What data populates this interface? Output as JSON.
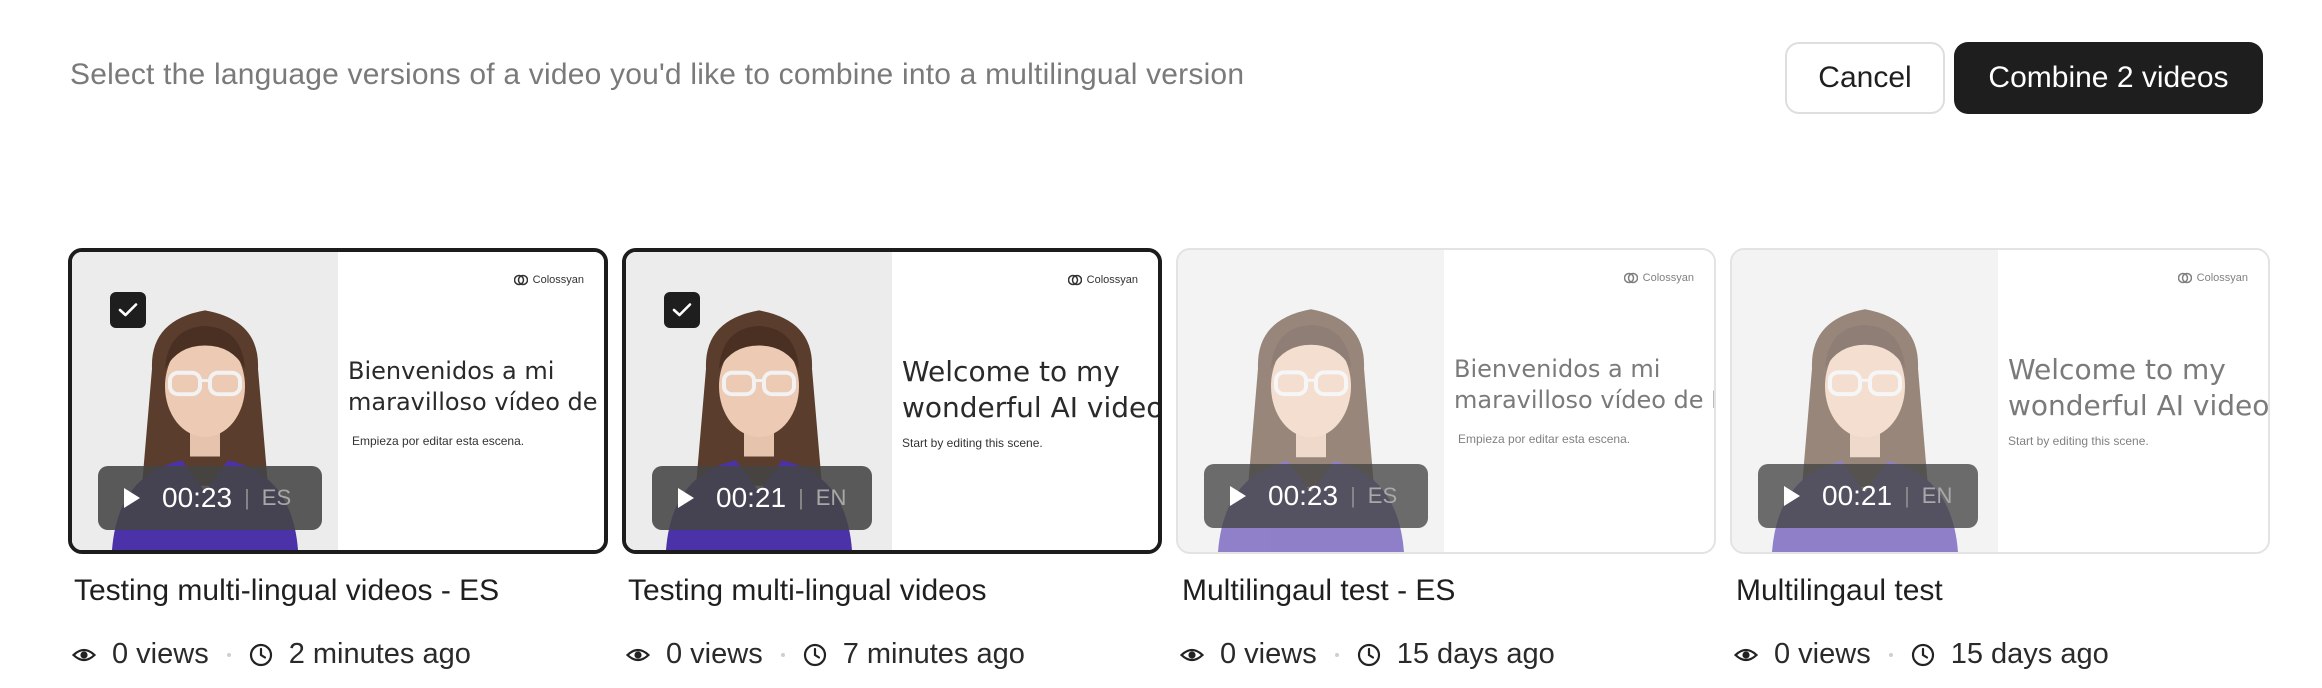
{
  "header": {
    "instruction": "Select the language versions of a video you'd like to combine into a multilingual version",
    "cancel_label": "Cancel",
    "combine_label": "Combine 2 videos"
  },
  "videos": [
    {
      "title": "Testing multi-lingual videos - ES",
      "duration": "00:23",
      "language": "ES",
      "views": "0 views",
      "age": "2 minutes ago",
      "selected": true,
      "brand": "Colossyan",
      "slide_heading_1": "Bienvenidos a mi",
      "slide_heading_2": "maravilloso vídeo de IA.",
      "slide_sub": "Empieza por editar esta escena."
    },
    {
      "title": "Testing multi-lingual videos",
      "duration": "00:21",
      "language": "EN",
      "views": "0 views",
      "age": "7 minutes ago",
      "selected": true,
      "brand": "Colossyan",
      "slide_heading_1": "Welcome to my",
      "slide_heading_2": "wonderful AI video.",
      "slide_sub": "Start by editing this scene."
    },
    {
      "title": "Multilingaul test - ES",
      "duration": "00:23",
      "language": "ES",
      "views": "0 views",
      "age": "15 days ago",
      "selected": false,
      "brand": "Colossyan",
      "slide_heading_1": "Bienvenidos a mi",
      "slide_heading_2": "maravilloso vídeo de IA",
      "slide_sub": "Empieza por editar esta escena."
    },
    {
      "title": "Multilingaul test",
      "duration": "00:21",
      "language": "EN",
      "views": "0 views",
      "age": "15 days ago",
      "selected": false,
      "brand": "Colossyan",
      "slide_heading_1": "Welcome to my",
      "slide_heading_2": "wonderful AI video.",
      "slide_sub": "Start by editing this scene."
    }
  ],
  "colors": {
    "primary_button": "#1e1e1e",
    "selected_border": "#1c1c1c",
    "sweater": "#4b32a8"
  },
  "icons": {
    "views": "eye-icon",
    "age": "clock-icon",
    "play": "play-icon",
    "checkbox": "checkmark-icon"
  }
}
